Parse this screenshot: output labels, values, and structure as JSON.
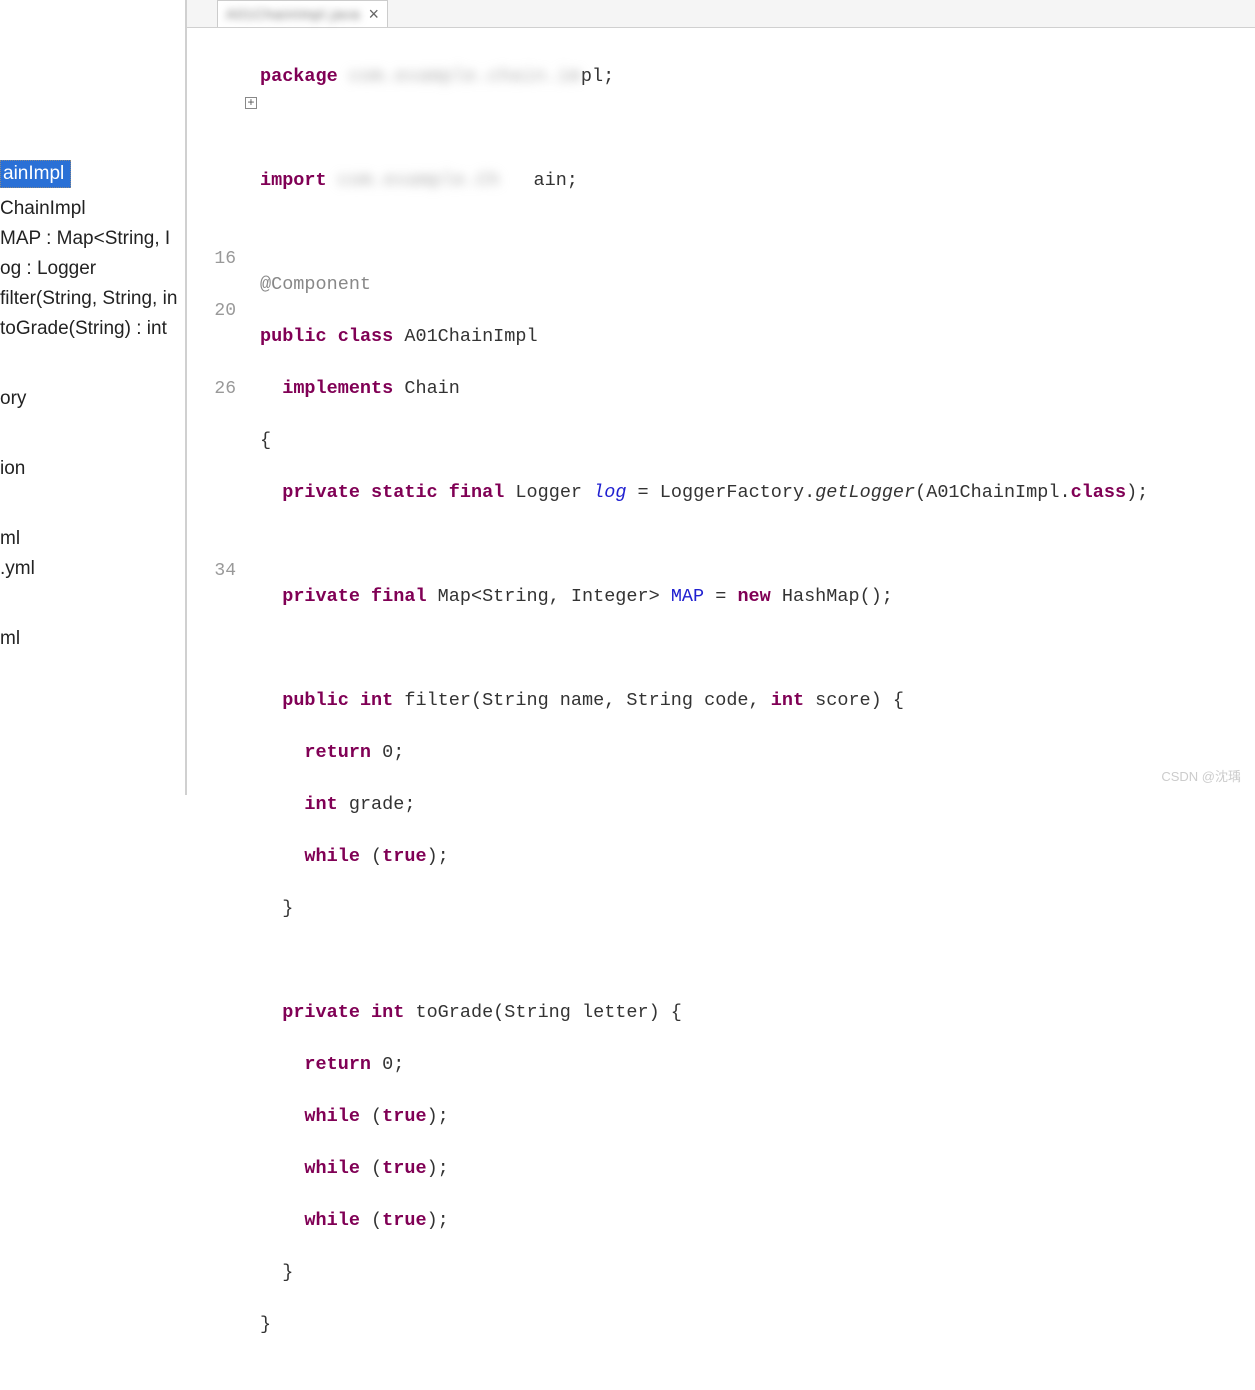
{
  "sidebar": {
    "items": [
      {
        "label": "ainImpl",
        "selected": true
      },
      {
        "label": "ChainImpl"
      },
      {
        "label": "MAP : Map<String, I"
      },
      {
        "label": "og : Logger"
      },
      {
        "label": "filter(String, String, in"
      },
      {
        "label": "toGrade(String) : int"
      }
    ],
    "group2": [
      {
        "label": "ory"
      }
    ],
    "group3": [
      {
        "label": "ion"
      }
    ],
    "group4": [
      {
        "label": "ml"
      },
      {
        "label": ".yml"
      }
    ],
    "group5": [
      {
        "label": "ml"
      }
    ]
  },
  "tab": {
    "title": "A01ChainImpl.java",
    "close": "×"
  },
  "gutter": {
    "lines": [
      "",
      "",
      "",
      "",
      "",
      "",
      "",
      "",
      "16",
      "",
      "20",
      "",
      "",
      "26",
      "",
      "",
      "",
      "",
      "",
      "",
      "34",
      "",
      "",
      "",
      "",
      ""
    ]
  },
  "code": {
    "package_kw": "package",
    "package_val": "com.example.chain.im",
    "package_suffix": "pl;",
    "import_kw": "import",
    "import_val": "com.example.Ch",
    "import_suffix": "ain;",
    "annotation": "@Component",
    "public": "public",
    "class": "class",
    "classname": "A01ChainImpl",
    "implements": "implements",
    "iface": "Chain",
    "brace_open": "{",
    "private": "private",
    "static": "static",
    "final": "final",
    "logger_type": "Logger",
    "log_field": "log",
    "eq": " = ",
    "logger_fact": "LoggerFactory.",
    "getlogger": "getLogger",
    "getlogger_args": "(A01ChainImpl.",
    "class_ref": "class",
    "close_paren_semi": ");",
    "map_decl_1": "Map<String, Integer>",
    "map_field": "MAP",
    "new": "new",
    "hashmap": "HashMap();",
    "int": "int",
    "filter_sig": " filter(String name, String code, ",
    "score_param": " score) {",
    "return": "return",
    "zero": " 0;",
    "grade_decl": " grade;",
    "while": "while",
    "true": "true",
    "while_close": ");",
    "brace_close": "}",
    "tograde_sig": " toGrade(String letter) {"
  },
  "watermark": "CSDN @沈瑀"
}
